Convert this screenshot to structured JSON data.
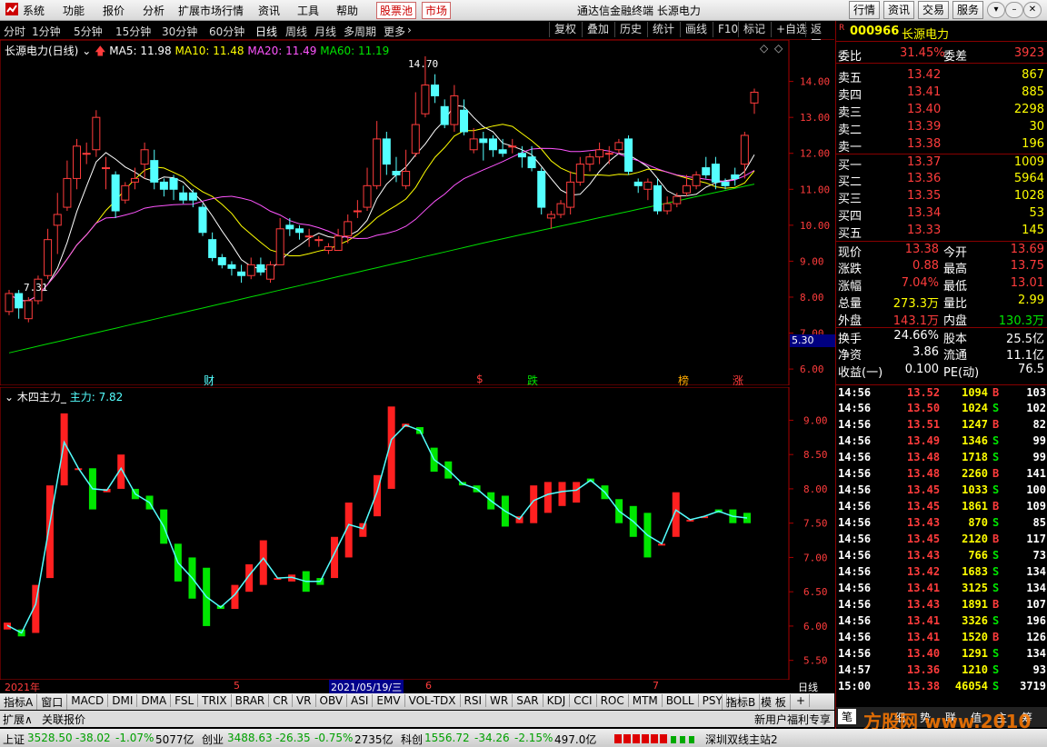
{
  "menu": {
    "items": [
      "系统",
      "功能",
      "报价",
      "分析",
      "扩展市场行情",
      "资讯",
      "工具",
      "帮助"
    ],
    "stockpool": "股票池",
    "market": "市场",
    "title": "通达信金融终端  长源电力",
    "right_buttons": [
      "行情",
      "资讯",
      "交易",
      "服务"
    ]
  },
  "periods": [
    "分时",
    "1分钟",
    "5分钟",
    "15分钟",
    "30分钟",
    "60分钟",
    "日线",
    "周线",
    "月线",
    "多周期",
    "更多"
  ],
  "tools": [
    "复权",
    "叠加",
    "历史",
    "统计",
    "画线",
    "F10",
    "标记",
    "+自选",
    "返回"
  ],
  "main_chart": {
    "title": "长源电力(日线)",
    "ma5": "MA5: 11.98",
    "ma10": "MA10: 11.48",
    "ma20": "MA20: 11.49",
    "ma60": "MA60: 11.19",
    "high_label": "14.70",
    "low_label": "7.31",
    "price_box": "5.30",
    "markers": [
      "财",
      "$",
      "跌",
      "榜",
      "涨"
    ]
  },
  "sub_chart": {
    "title": "木四主力_",
    "value": "主力: 7.82"
  },
  "chart_data": [
    {
      "type": "candlestick",
      "title": "长源电力(日线)",
      "ylim": [
        5.8,
        14.9
      ],
      "yticks": [
        "14.00",
        "13.00",
        "12.00",
        "11.00",
        "10.00",
        "9.00",
        "8.00",
        "7.00",
        "6.00"
      ],
      "x_labels": [
        "2021年",
        "5",
        "2021/05/19/三",
        "6",
        "7",
        "日线"
      ],
      "candles": [
        [
          7.6,
          8.1,
          7.5,
          8.2
        ],
        [
          8.1,
          7.7,
          7.4,
          8.2
        ],
        [
          7.4,
          7.9,
          7.3,
          8.0
        ],
        [
          7.9,
          8.5,
          7.8,
          8.6
        ],
        [
          8.6,
          9.6,
          8.5,
          9.9
        ],
        [
          10.0,
          10.3,
          9.2,
          10.9
        ],
        [
          10.5,
          11.3,
          10.4,
          11.8
        ],
        [
          11.3,
          12.2,
          11.0,
          12.4
        ],
        [
          12.0,
          12.0,
          11.7,
          12.3
        ],
        [
          12.1,
          13.0,
          11.9,
          13.2
        ],
        [
          11.6,
          11.6,
          11.0,
          11.9
        ],
        [
          11.4,
          10.4,
          10.2,
          11.5
        ],
        [
          10.7,
          11.1,
          10.6,
          11.2
        ],
        [
          11.2,
          11.3,
          11.0,
          11.6
        ],
        [
          11.7,
          12.1,
          11.3,
          12.3
        ],
        [
          11.8,
          11.2,
          11.0,
          12.1
        ],
        [
          11.2,
          11.0,
          10.8,
          11.3
        ],
        [
          11.3,
          11.0,
          10.7,
          11.4
        ],
        [
          10.9,
          10.7,
          10.6,
          11.1
        ],
        [
          10.9,
          10.7,
          10.5,
          11.0
        ],
        [
          10.5,
          9.8,
          9.7,
          10.6
        ],
        [
          9.6,
          9.1,
          9.0,
          9.8
        ],
        [
          9.1,
          8.9,
          8.8,
          9.2
        ],
        [
          8.9,
          8.8,
          8.6,
          9.0
        ],
        [
          8.7,
          8.6,
          8.4,
          8.9
        ],
        [
          8.6,
          8.9,
          8.5,
          9.1
        ],
        [
          8.9,
          8.7,
          8.6,
          9.1
        ],
        [
          8.5,
          8.9,
          8.4,
          9.0
        ],
        [
          8.9,
          9.9,
          8.9,
          10.2
        ],
        [
          10.0,
          9.9,
          9.7,
          10.2
        ],
        [
          9.9,
          9.8,
          9.6,
          10.0
        ],
        [
          9.7,
          9.7,
          9.4,
          9.9
        ],
        [
          9.6,
          9.6,
          9.4,
          9.7
        ],
        [
          9.3,
          9.4,
          9.2,
          9.5
        ],
        [
          9.3,
          9.7,
          9.3,
          9.9
        ],
        [
          9.7,
          10.1,
          9.5,
          10.3
        ],
        [
          10.4,
          10.4,
          10.2,
          10.7
        ],
        [
          10.5,
          11.1,
          10.4,
          11.6
        ],
        [
          11.1,
          12.4,
          11.0,
          12.9
        ],
        [
          12.4,
          11.7,
          11.4,
          12.6
        ],
        [
          11.5,
          11.4,
          11.2,
          11.9
        ],
        [
          11.1,
          11.5,
          11.0,
          12.1
        ],
        [
          12.0,
          12.8,
          11.9,
          13.7
        ],
        [
          13.1,
          13.9,
          13.0,
          14.7
        ],
        [
          13.9,
          13.6,
          13.4,
          14.2
        ],
        [
          13.3,
          12.8,
          12.7,
          13.5
        ],
        [
          12.8,
          13.6,
          12.6,
          13.9
        ],
        [
          13.2,
          12.6,
          12.5,
          13.5
        ],
        [
          12.1,
          12.4,
          12.0,
          12.7
        ],
        [
          12.4,
          12.3,
          11.8,
          12.6
        ],
        [
          12.4,
          12.1,
          11.9,
          12.5
        ],
        [
          12.1,
          12.0,
          11.9,
          12.4
        ],
        [
          12.2,
          12.2,
          12.0,
          12.4
        ],
        [
          12.0,
          11.9,
          11.6,
          12.2
        ],
        [
          11.9,
          11.6,
          11.5,
          12.2
        ],
        [
          11.5,
          10.5,
          10.3,
          11.6
        ],
        [
          10.2,
          10.3,
          9.9,
          10.4
        ],
        [
          10.3,
          10.6,
          10.2,
          10.7
        ],
        [
          10.5,
          11.2,
          10.3,
          11.5
        ],
        [
          11.2,
          11.7,
          11.1,
          11.9
        ],
        [
          11.7,
          11.9,
          11.5,
          12.0
        ],
        [
          11.9,
          12.1,
          11.7,
          12.3
        ],
        [
          12.0,
          12.0,
          11.7,
          12.2
        ],
        [
          12.1,
          12.3,
          12.0,
          12.4
        ],
        [
          12.4,
          11.5,
          11.4,
          12.5
        ],
        [
          11.2,
          11.1,
          10.9,
          11.3
        ],
        [
          11.0,
          11.2,
          10.7,
          11.3
        ],
        [
          11.1,
          10.4,
          10.3,
          11.3
        ],
        [
          10.4,
          10.6,
          10.3,
          10.8
        ],
        [
          10.6,
          10.8,
          10.5,
          10.9
        ],
        [
          10.9,
          11.1,
          10.8,
          11.4
        ],
        [
          11.1,
          11.4,
          11.0,
          11.5
        ],
        [
          11.6,
          11.4,
          11.3,
          11.9
        ],
        [
          11.7,
          11.2,
          11.0,
          11.9
        ],
        [
          11.2,
          11.1,
          11.0,
          11.3
        ],
        [
          11.4,
          11.3,
          11.1,
          11.6
        ],
        [
          11.7,
          12.5,
          11.3,
          12.6
        ],
        [
          13.4,
          13.7,
          13.1,
          13.8
        ]
      ],
      "series": [
        {
          "name": "MA5",
          "color": "#ffffff"
        },
        {
          "name": "MA10",
          "color": "#ffff00"
        },
        {
          "name": "MA20",
          "color": "#ff55ff"
        },
        {
          "name": "MA60",
          "color": "#00dd00"
        }
      ]
    },
    {
      "type": "bar",
      "title": "木四主力_",
      "ylim": [
        5.35,
        9.35
      ],
      "yticks": [
        "9.00",
        "8.50",
        "8.00",
        "7.50",
        "7.00",
        "6.50",
        "6.00",
        "5.50"
      ],
      "bars": [
        [
          5.95,
          6.05
        ],
        [
          5.95,
          5.85
        ],
        [
          5.9,
          6.6
        ],
        [
          6.7,
          8.05
        ],
        [
          8.05,
          9.1
        ],
        [
          8.3,
          8.3
        ],
        [
          8.3,
          7.7
        ],
        [
          7.95,
          8.0
        ],
        [
          8.0,
          8.5
        ],
        [
          8.0,
          7.85
        ],
        [
          7.9,
          7.7
        ],
        [
          7.7,
          7.2
        ],
        [
          7.2,
          6.65
        ],
        [
          7.0,
          6.4
        ],
        [
          6.85,
          6.0
        ],
        [
          6.3,
          6.25
        ],
        [
          6.25,
          6.6
        ],
        [
          6.5,
          6.9
        ],
        [
          6.6,
          7.25
        ],
        [
          6.7,
          6.7
        ],
        [
          6.65,
          6.75
        ],
        [
          6.8,
          6.5
        ],
        [
          6.7,
          6.6
        ],
        [
          6.7,
          7.3
        ],
        [
          7.0,
          7.8
        ],
        [
          7.3,
          7.5
        ],
        [
          7.6,
          8.2
        ],
        [
          8.0,
          9.2
        ],
        [
          8.9,
          8.95
        ],
        [
          8.9,
          8.8
        ],
        [
          8.6,
          8.25
        ],
        [
          8.4,
          8.15
        ],
        [
          8.1,
          8.05
        ],
        [
          8.05,
          7.95
        ],
        [
          7.95,
          7.7
        ],
        [
          7.9,
          7.45
        ],
        [
          7.5,
          7.6
        ],
        [
          7.5,
          8.05
        ],
        [
          7.65,
          8.1
        ],
        [
          7.75,
          8.1
        ],
        [
          7.8,
          8.1
        ],
        [
          8.15,
          8.1
        ],
        [
          8.05,
          7.85
        ],
        [
          7.85,
          7.5
        ],
        [
          7.75,
          7.3
        ],
        [
          7.65,
          7.0
        ],
        [
          7.2,
          7.2
        ],
        [
          7.3,
          7.95
        ],
        [
          7.55,
          7.55
        ],
        [
          7.6,
          7.6
        ],
        [
          7.7,
          7.65
        ],
        [
          7.7,
          7.5
        ],
        [
          7.65,
          7.5
        ]
      ],
      "line_color": "#54ffff"
    }
  ],
  "quote": {
    "code": "000966",
    "name": "长源电力",
    "weibi_label": "委比",
    "weibi": "31.45%",
    "weicha_label": "委差",
    "weicha": "3923",
    "sell": [
      {
        "label": "卖五",
        "price": "13.42",
        "vol": "867"
      },
      {
        "label": "卖四",
        "price": "13.41",
        "vol": "885"
      },
      {
        "label": "卖三",
        "price": "13.40",
        "vol": "2298"
      },
      {
        "label": "卖二",
        "price": "13.39",
        "vol": "30"
      },
      {
        "label": "卖一",
        "price": "13.38",
        "vol": "196"
      }
    ],
    "buy": [
      {
        "label": "买一",
        "price": "13.37",
        "vol": "1009"
      },
      {
        "label": "买二",
        "price": "13.36",
        "vol": "5964"
      },
      {
        "label": "买三",
        "price": "13.35",
        "vol": "1028"
      },
      {
        "label": "买四",
        "price": "13.34",
        "vol": "53"
      },
      {
        "label": "买五",
        "price": "13.33",
        "vol": "145"
      }
    ],
    "stats": [
      {
        "l1": "现价",
        "v1": "13.38",
        "l2": "今开",
        "v2": "13.69"
      },
      {
        "l1": "涨跌",
        "v1": "0.88",
        "l2": "最高",
        "v2": "13.75"
      },
      {
        "l1": "涨幅",
        "v1": "7.04%",
        "l2": "最低",
        "v2": "13.01"
      },
      {
        "l1": "总量",
        "v1": "273.3万",
        "l2": "量比",
        "v2": "2.99"
      },
      {
        "l1": "外盘",
        "v1": "143.1万",
        "l2": "内盘",
        "v2": "130.3万"
      },
      {
        "l1": "换手",
        "v1": "24.66%",
        "l2": "股本",
        "v2": "25.5亿"
      },
      {
        "l1": "净资",
        "v1": "3.86",
        "l2": "流通",
        "v2": "11.1亿"
      },
      {
        "l1": "收益(一)",
        "v1": "0.100",
        "l2": "PE(动)",
        "v2": "76.5"
      }
    ],
    "ticks": [
      [
        "14:56",
        "13.52",
        "1094",
        "B",
        "103"
      ],
      [
        "14:56",
        "13.50",
        "1024",
        "S",
        "102"
      ],
      [
        "14:56",
        "13.51",
        "1247",
        "B",
        "82"
      ],
      [
        "14:56",
        "13.49",
        "1346",
        "S",
        "99"
      ],
      [
        "14:56",
        "13.48",
        "1718",
        "S",
        "99"
      ],
      [
        "14:56",
        "13.48",
        "2260",
        "B",
        "141"
      ],
      [
        "14:56",
        "13.45",
        "1033",
        "S",
        "100"
      ],
      [
        "14:56",
        "13.45",
        "1861",
        "B",
        "109"
      ],
      [
        "14:56",
        "13.43",
        "870",
        "S",
        "85"
      ],
      [
        "14:56",
        "13.45",
        "2120",
        "B",
        "117"
      ],
      [
        "14:56",
        "13.43",
        "766",
        "S",
        "73"
      ],
      [
        "14:56",
        "13.42",
        "1683",
        "S",
        "134"
      ],
      [
        "14:56",
        "13.41",
        "3125",
        "S",
        "134"
      ],
      [
        "14:56",
        "13.43",
        "1891",
        "B",
        "107"
      ],
      [
        "14:56",
        "13.41",
        "3326",
        "S",
        "196"
      ],
      [
        "14:56",
        "13.41",
        "1520",
        "B",
        "126"
      ],
      [
        "14:56",
        "13.40",
        "1291",
        "S",
        "134"
      ],
      [
        "14:57",
        "13.36",
        "1210",
        "S",
        "93"
      ],
      [
        "15:00",
        "13.38",
        "46054",
        "S",
        "3719"
      ]
    ]
  },
  "indicator_tabs": [
    "指标A",
    "窗口",
    "MACD",
    "DMI",
    "DMA",
    "FSL",
    "TRIX",
    "BRAR",
    "CR",
    "VR",
    "OBV",
    "ASI",
    "EMV",
    "VOL-TDX",
    "RSI",
    "WR",
    "SAR",
    "KDJ",
    "CCI",
    "ROC",
    "MTM",
    "BOLL",
    "PSY"
  ],
  "indicator_right": [
    "指标B",
    "模 板",
    "+"
  ],
  "link_bar": {
    "expand": "扩展∧",
    "related": "关联报价",
    "promo": "新用户福利专享"
  },
  "status": {
    "sh_label": "上证",
    "sh_val": "3528.50",
    "sh_chg": "-38.02",
    "sh_pct": "-1.07%",
    "sh_amt": "5077亿",
    "cy_label": "创业",
    "cy_val": "3488.63",
    "cy_chg": "-26.35",
    "cy_pct": "-0.75%",
    "cy_amt": "2735亿",
    "kc_label": "科创",
    "kc_val": "1556.72",
    "kc_chg": "-34.26",
    "kc_pct": "-2.15%",
    "kc_amt": "497.0亿",
    "station": "深圳双线主站2"
  },
  "right_tabs": [
    "笔",
    "细",
    "势",
    "联",
    "值",
    "主",
    "筹"
  ],
  "watermark": "方股网 www.2010"
}
